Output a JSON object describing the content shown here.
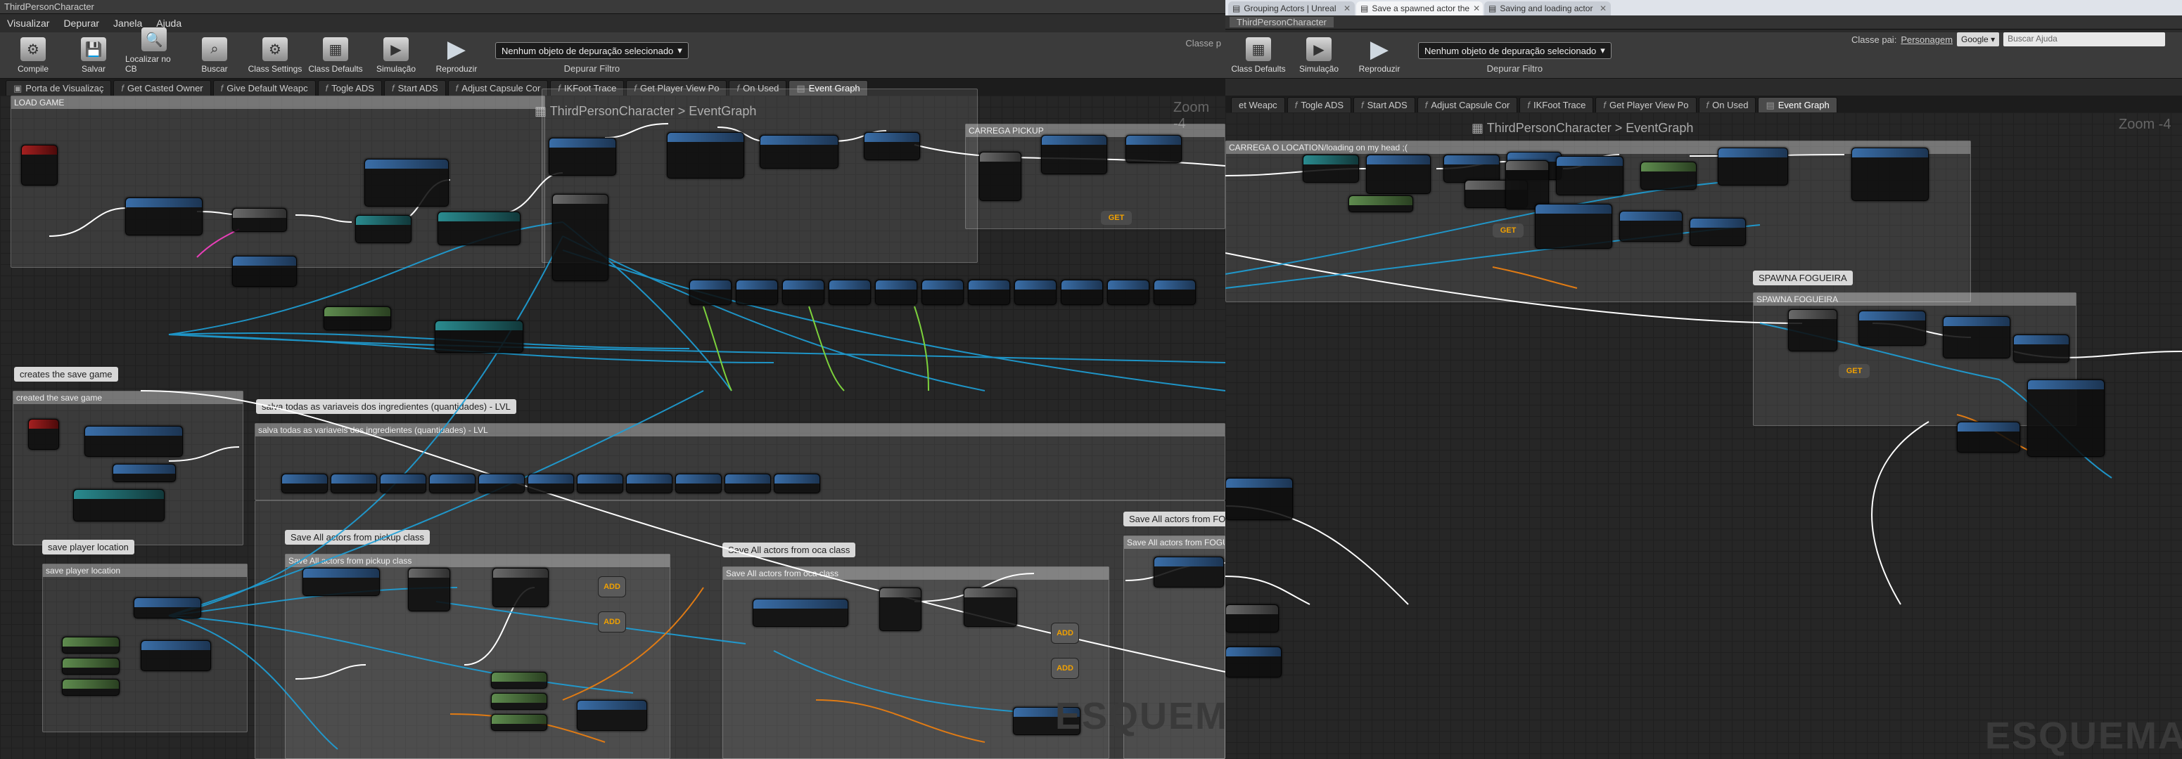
{
  "left": {
    "window_title": "ThirdPersonCharacter",
    "menu": [
      "Visualizar",
      "Depurar",
      "Janela",
      "Ajuda"
    ],
    "toolbar": [
      "Compile",
      "Salvar",
      "Localizar no CB",
      "Buscar",
      "Class Settings",
      "Class Defaults",
      "Simulação",
      "Reproduzir"
    ],
    "debug_object": "Nenhum objeto de depuração selecionado",
    "debug_filter": "Depurar Filtro",
    "parent_class": "Classe p",
    "tabs": [
      "Porta de Visualizaç",
      "Get Casted Owner",
      "Give Default Weapc",
      "Togle ADS",
      "Start ADS",
      "Adjust Capsule Cor",
      "IKFoot Trace",
      "Get Player View Po",
      "On Used",
      "Event Graph"
    ],
    "breadcrumb_class": "ThirdPersonCharacter",
    "breadcrumb_graph": "EventGraph",
    "zoom": "Zoom -4",
    "watermark": "ESQUEMA"
  },
  "right": {
    "browser_tabs": [
      "Grouping Actors | Unreal",
      "Save a spawned actor the",
      "Saving and loading actor"
    ],
    "window_tab": "ThirdPersonCharacter",
    "toolbar": [
      "Class Defaults",
      "Simulação",
      "Reproduzir"
    ],
    "debug_object": "Nenhum objeto de depuração selecionado",
    "debug_filter": "Depurar Filtro",
    "parent_class_label": "Classe pai:",
    "parent_class_value": "Personagem",
    "search_engine": "Google",
    "search_placeholder": "Buscar Ajuda",
    "tabs": [
      "et Weapc",
      "Togle ADS",
      "Start ADS",
      "Adjust Capsule Cor",
      "IKFoot Trace",
      "Get Player View Po",
      "On Used",
      "Event Graph"
    ],
    "breadcrumb_class": "ThirdPersonCharacter",
    "breadcrumb_graph": "EventGraph",
    "zoom": "Zoom -4",
    "watermark": "ESQUEMA"
  },
  "comments": {
    "load_game": "LOAD GAME",
    "carrega_pickup": "CARREGA PICKUP",
    "carrega_hint": "CARREGA O LOCATION/loading on my head ;(",
    "spawna": "SPAWNA FOGUEIRA",
    "creates": "creates the save game",
    "created": "created the save game",
    "salva_bubble": "salva todas as variaveis dos ingredientes (quantidades) - LVL",
    "salva_head": "salva todas as variaveis dos ingredientes (quantidades) - LVL",
    "save_location_bubble": "save player location",
    "save_location": "save player location",
    "pickup_bubble": "Save All actors from pickup class",
    "pickup_head": "Save All actors from pickup class",
    "oca_bubble": "Save All actors from oca class",
    "oca_head": "Save All actors from oca class",
    "fogueira_bubble": "Save All actors from FOGUEIRA class",
    "fogueira_head": "Save All actors from FOGUEIRA class"
  },
  "nodes": {
    "add": "ADD",
    "get": "GET"
  }
}
